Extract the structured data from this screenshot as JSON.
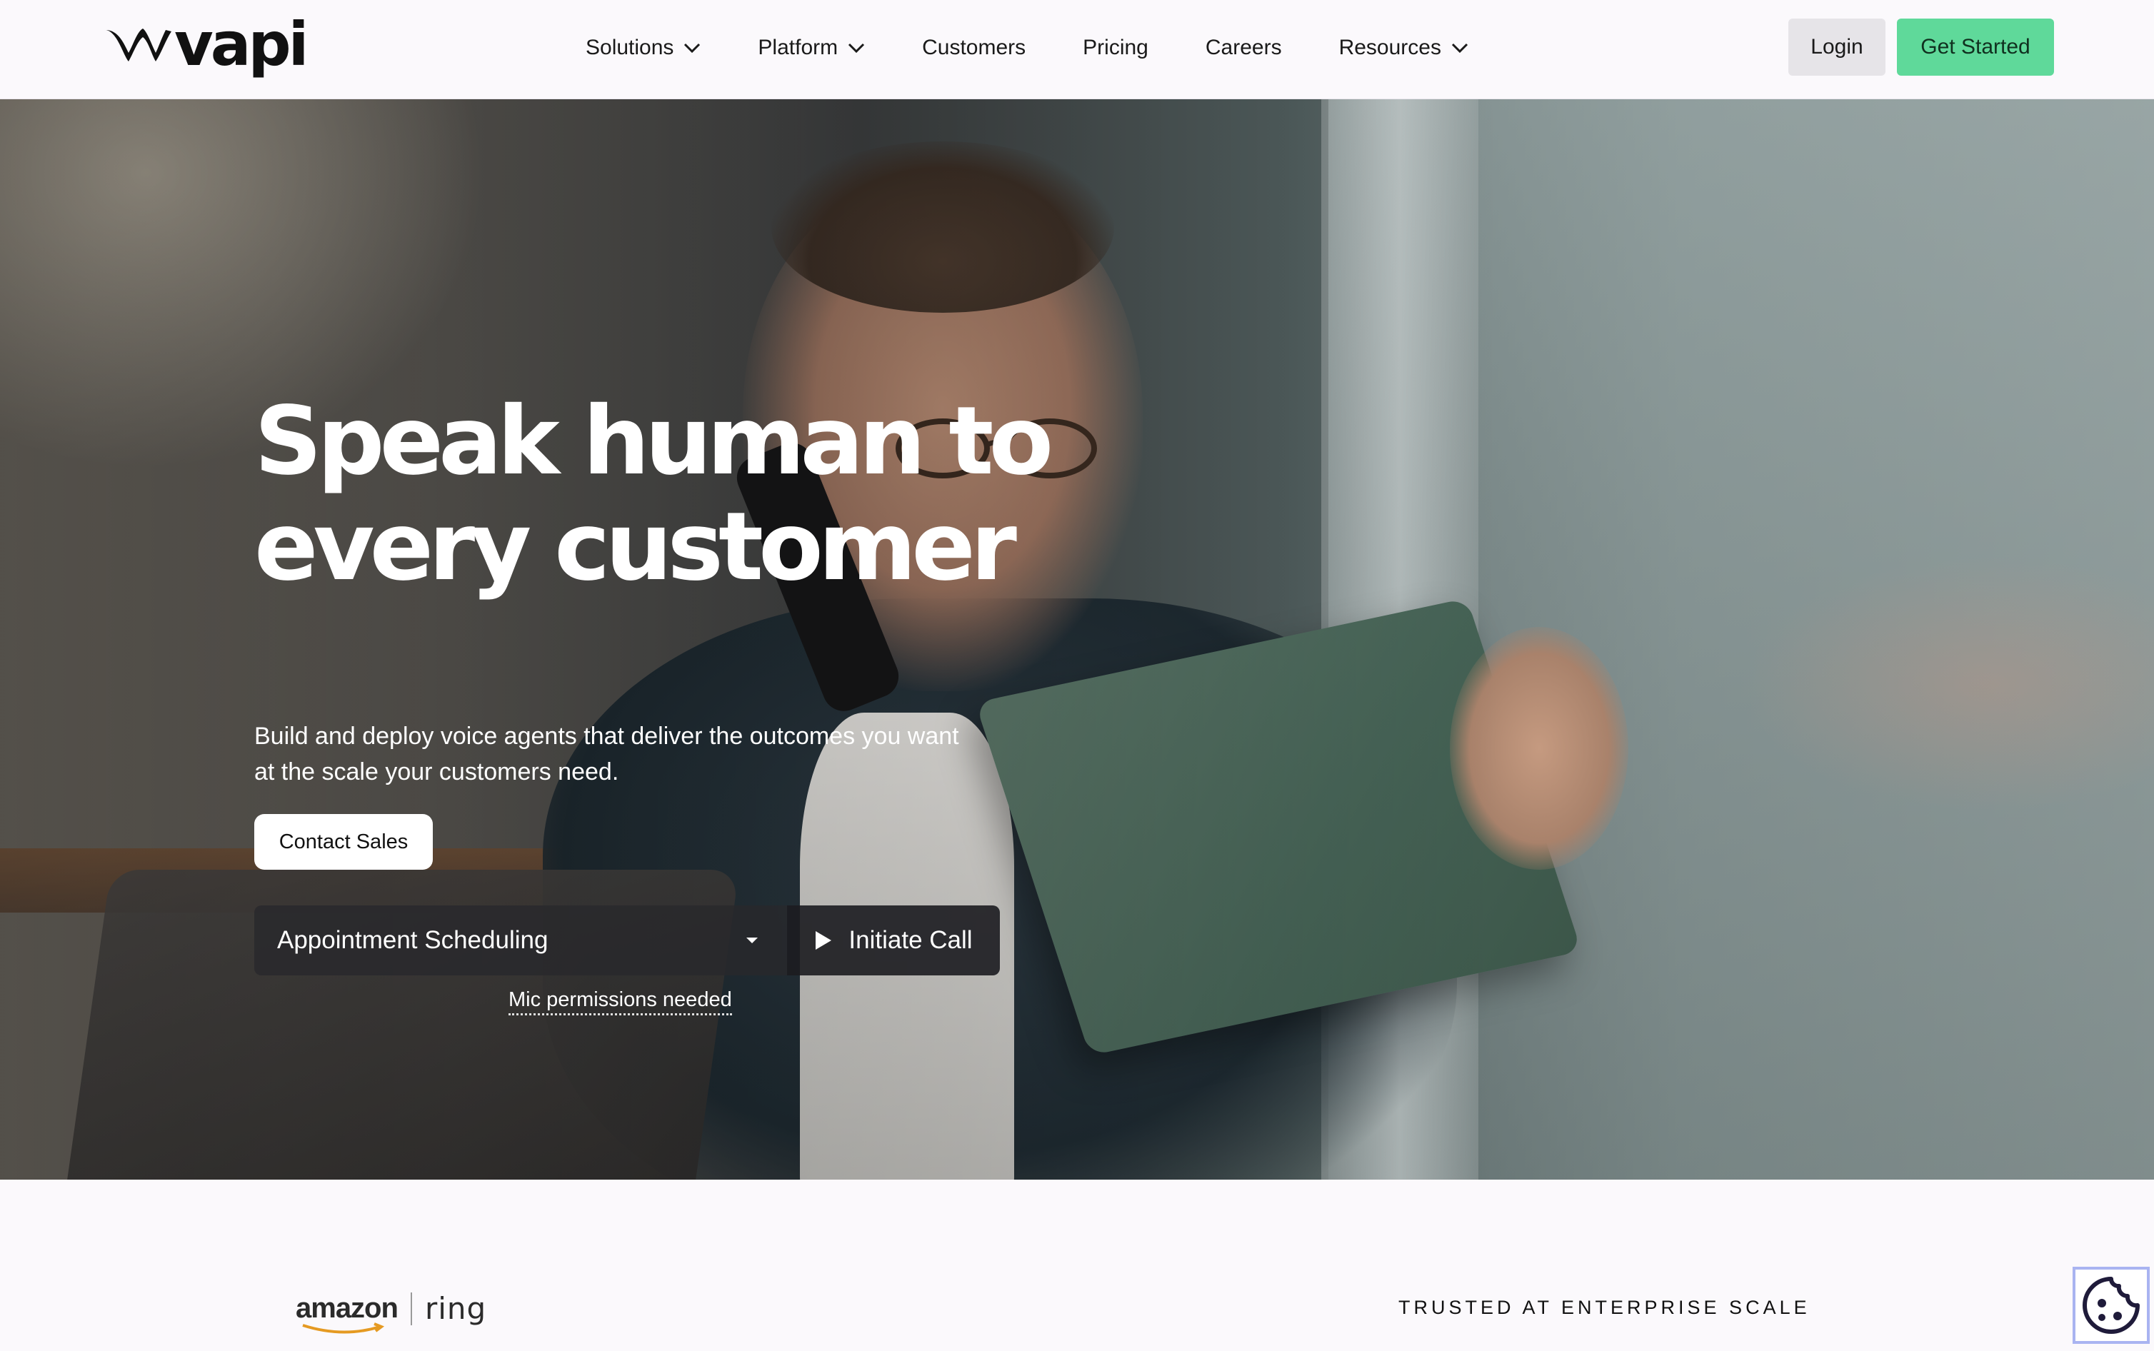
{
  "nav": {
    "logo_text": "vapi",
    "menu": [
      {
        "label": "Solutions",
        "has_dropdown": true
      },
      {
        "label": "Platform",
        "has_dropdown": true
      },
      {
        "label": "Customers",
        "has_dropdown": false
      },
      {
        "label": "Pricing",
        "has_dropdown": false
      },
      {
        "label": "Careers",
        "has_dropdown": false
      },
      {
        "label": "Resources",
        "has_dropdown": true
      }
    ],
    "login_label": "Login",
    "get_started_label": "Get Started"
  },
  "hero": {
    "headline_line1": "Speak human to",
    "headline_line2": "every customer",
    "subtitle": "Build and deploy voice agents that deliver the outcomes you want at the scale your customers need.",
    "contact_sales_label": "Contact Sales",
    "scenario_selected": "Appointment Scheduling",
    "initiate_call_label": "Initiate Call",
    "mic_note": "Mic permissions needed"
  },
  "trust": {
    "logo_amazon": "amazon",
    "logo_ring": "ring",
    "label": "TRUSTED AT ENTERPRISE SCALE"
  },
  "colors": {
    "accent_green": "#5fd99a",
    "login_bg": "#e6e4e8",
    "page_bg": "#fbf9fc"
  },
  "icons": {
    "dropdown": "chevron-down-icon",
    "play": "play-icon",
    "caret": "caret-down-icon",
    "cookie": "cookie-icon"
  }
}
